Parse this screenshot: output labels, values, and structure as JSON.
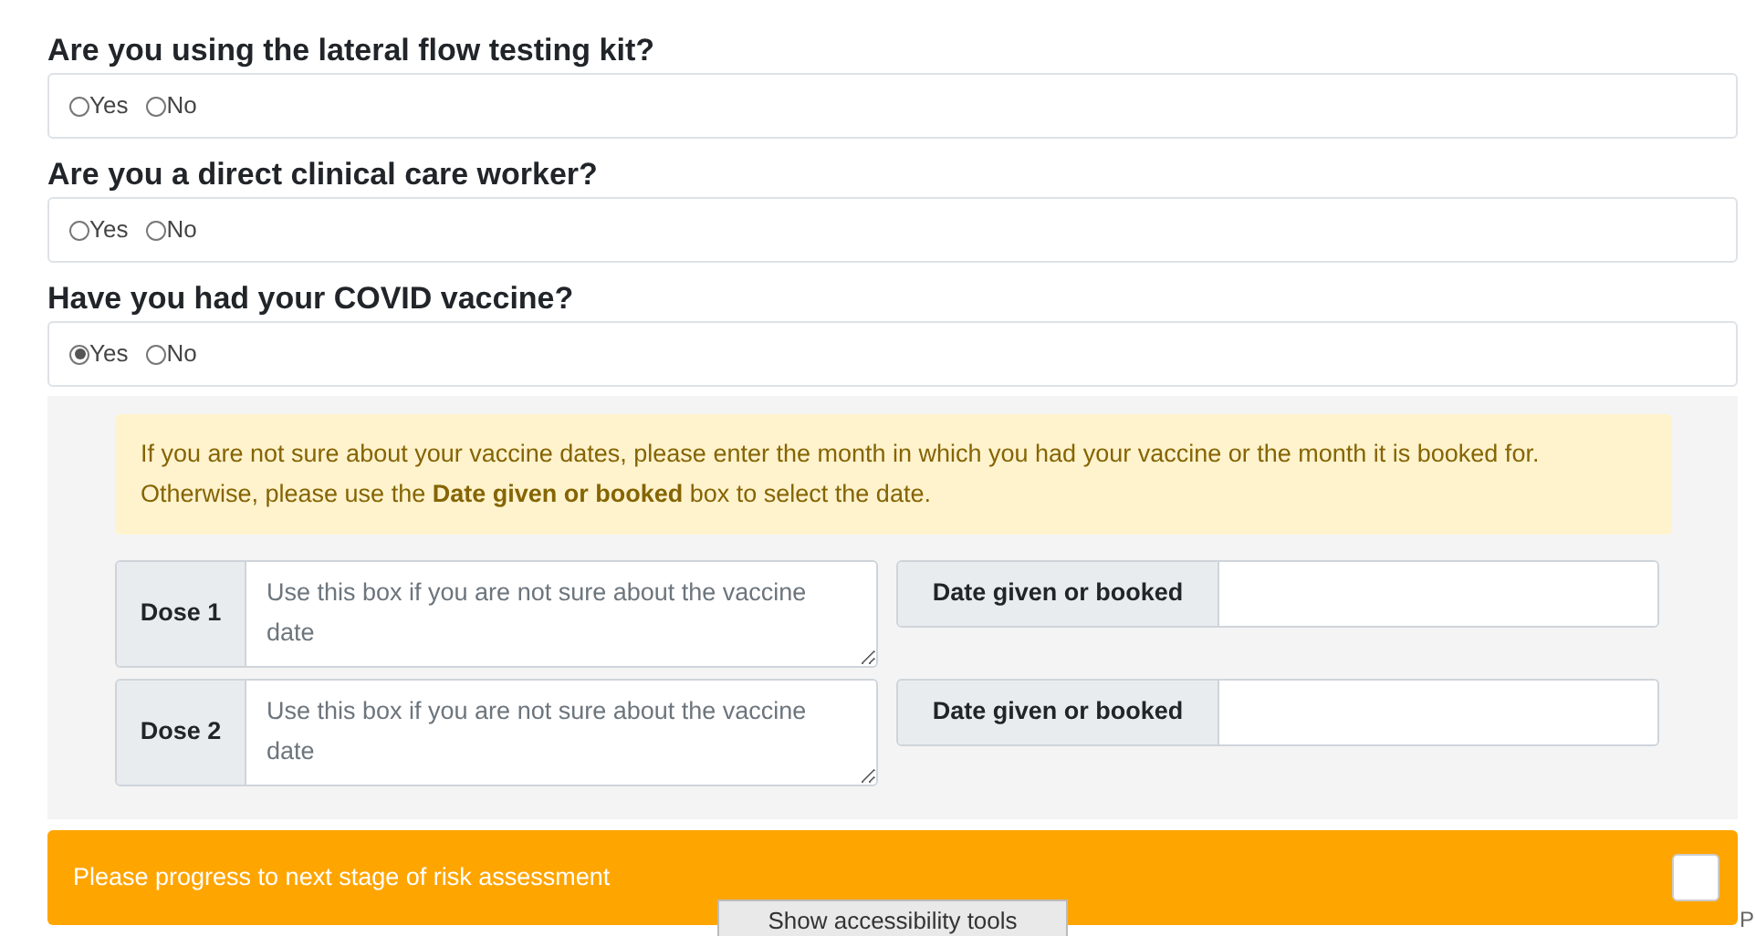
{
  "questions": [
    {
      "label": "Are you using the lateral flow testing kit?",
      "options": [
        {
          "label": "Yes",
          "selected": false
        },
        {
          "label": "No",
          "selected": false
        }
      ]
    },
    {
      "label": "Are you a direct clinical care worker?",
      "options": [
        {
          "label": "Yes",
          "selected": false
        },
        {
          "label": "No",
          "selected": false
        }
      ]
    },
    {
      "label": "Have you had your COVID vaccine?",
      "options": [
        {
          "label": "Yes",
          "selected": true
        },
        {
          "label": "No",
          "selected": false
        }
      ]
    }
  ],
  "vaccine_panel": {
    "notice": "If you are not sure about your vaccine dates, please enter the month in which you had your vaccine or the month it is booked for. Otherwise, please use the **Date given or booked** box to select the date.",
    "doses": [
      {
        "label": "Dose 1",
        "placeholder": "Use this box if you are not sure about the vaccine date",
        "date_label": "Date given or booked"
      },
      {
        "label": "Dose 2",
        "placeholder": "Use this box if you are not sure about the vaccine date",
        "date_label": "Date given or booked"
      }
    ]
  },
  "progress_bar": {
    "label": "Please progress to next stage of risk assessment",
    "checked": false
  },
  "accessibility_button": "Show accessibility tools",
  "edge_text": "P"
}
